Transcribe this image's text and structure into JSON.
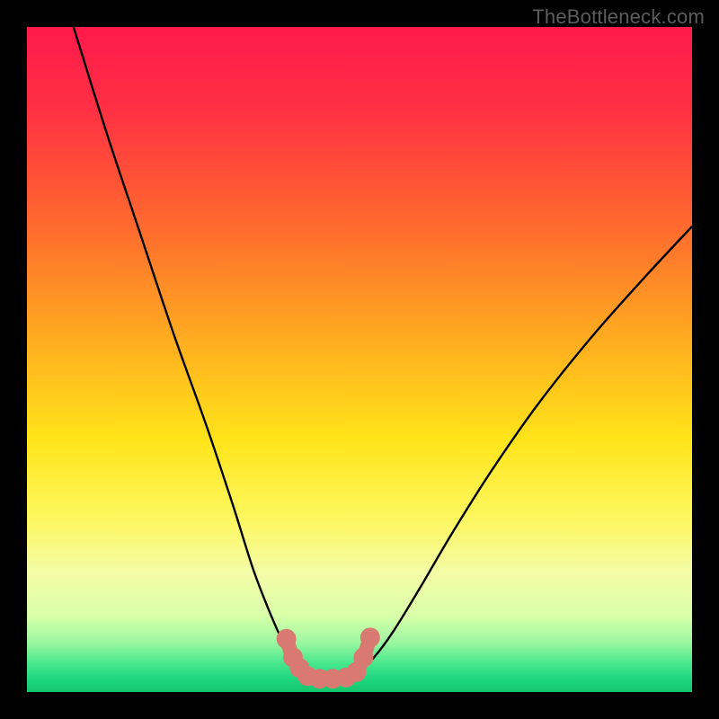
{
  "watermark": "TheBottleneck.com",
  "chart_data": {
    "type": "line",
    "title": "",
    "xlabel": "",
    "ylabel": "",
    "xlim": [
      0,
      100
    ],
    "ylim": [
      0,
      100
    ],
    "grid": false,
    "legend": false,
    "background_gradient_stops": [
      {
        "offset": 0.0,
        "color": "#ff1a4b"
      },
      {
        "offset": 0.12,
        "color": "#ff2f44"
      },
      {
        "offset": 0.3,
        "color": "#ff6a2e"
      },
      {
        "offset": 0.48,
        "color": "#ffb01f"
      },
      {
        "offset": 0.62,
        "color": "#ffe41a"
      },
      {
        "offset": 0.74,
        "color": "#fdf760"
      },
      {
        "offset": 0.82,
        "color": "#f4fca6"
      },
      {
        "offset": 0.885,
        "color": "#d9ffa9"
      },
      {
        "offset": 0.925,
        "color": "#9cf7a0"
      },
      {
        "offset": 0.955,
        "color": "#4ce88e"
      },
      {
        "offset": 0.98,
        "color": "#1fd77f"
      },
      {
        "offset": 1.0,
        "color": "#14c66e"
      }
    ],
    "series": [
      {
        "name": "bottleneck-curve-left",
        "color": "#000000",
        "x": [
          7,
          12,
          17,
          22,
          27,
          31,
          34,
          36.5,
          38.5,
          40,
          41.5
        ],
        "y": [
          100,
          84,
          69,
          54,
          40,
          28,
          18.5,
          12,
          7.5,
          4.8,
          3.5
        ]
      },
      {
        "name": "bottleneck-curve-right",
        "color": "#000000",
        "x": [
          50,
          52,
          55,
          59,
          64,
          70,
          77,
          85,
          93,
          100
        ],
        "y": [
          3.3,
          5.0,
          9.0,
          15.5,
          24.0,
          33.5,
          43.5,
          53.5,
          62.5,
          70.0
        ]
      },
      {
        "name": "valley-markers",
        "color": "#d97a72",
        "type": "scatter",
        "x": [
          39.0,
          40.0,
          41.0,
          42.2,
          44.0,
          46.0,
          48.0,
          49.5,
          50.6,
          51.6
        ],
        "y": [
          8.0,
          5.2,
          3.6,
          2.4,
          2.0,
          2.0,
          2.2,
          3.0,
          5.2,
          8.2
        ]
      }
    ]
  }
}
